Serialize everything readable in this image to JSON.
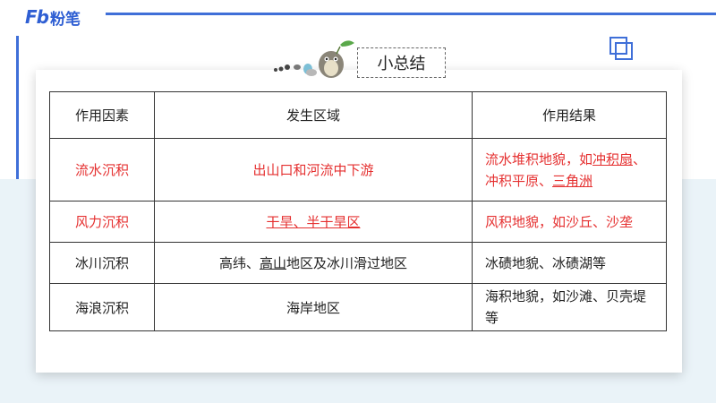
{
  "brand": {
    "logo_mark": "Fb",
    "logo_text": "粉笔"
  },
  "title": "小总结",
  "icons": [
    "fenbi-logo-icon",
    "mascot-icon",
    "stacked-squares-icon"
  ],
  "colors": {
    "accent": "#3f6fd8",
    "highlight": "#e53030",
    "border": "#333333"
  },
  "table": {
    "headers": [
      "作用因素",
      "发生区域",
      "作用结果"
    ],
    "rows": [
      {
        "factor": "流水沉积",
        "region": "出山口和河流中下游",
        "result": {
          "p1": "流水堆积地貌，如",
          "u1": "冲积扇",
          "p2": "、冲积平原、",
          "u2": "三角洲",
          "p3": ""
        },
        "highlight": true
      },
      {
        "factor": "风力沉积",
        "region": {
          "u1": "干旱、半干旱区"
        },
        "result": "风积地貌，如沙丘、沙垄",
        "highlight": true
      },
      {
        "factor": "冰川沉积",
        "region": {
          "p1": "高纬、",
          "u1": "高山",
          "p2": "地区及冰川滑过地区"
        },
        "result": "冰碛地貌、冰碛湖等",
        "highlight": false
      },
      {
        "factor": "海浪沉积",
        "region": "海岸地区",
        "result": "海积地貌，如沙滩、贝壳堤等",
        "highlight": false
      }
    ]
  }
}
